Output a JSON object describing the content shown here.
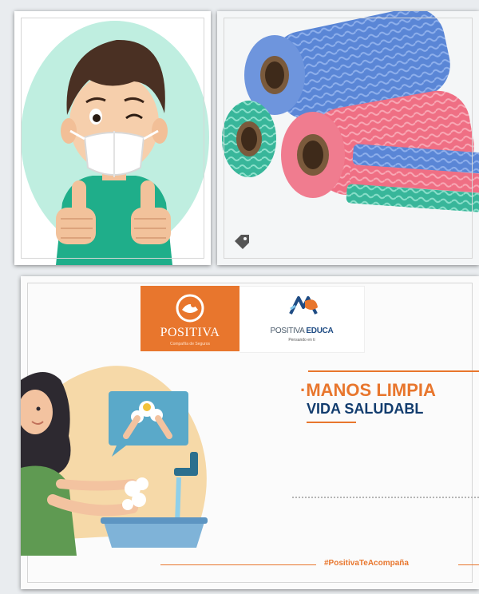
{
  "logo_positiva": {
    "brand": "POSITIVA",
    "tagline": "Compañía de Seguros"
  },
  "logo_educa": {
    "brand_prefix": "POSITIVA ",
    "brand_bold": "EDUCA",
    "subtitle": "Pensando en ti"
  },
  "headline": {
    "line1": "·MANOS LIMPIA",
    "line2": "VIDA SALUDABL"
  },
  "footer": {
    "hashtag": "#PositivaTeAcompaña"
  },
  "colors": {
    "brand_orange": "#e8762d",
    "brand_navy": "#123c6e",
    "mint": "#bfeee0"
  }
}
